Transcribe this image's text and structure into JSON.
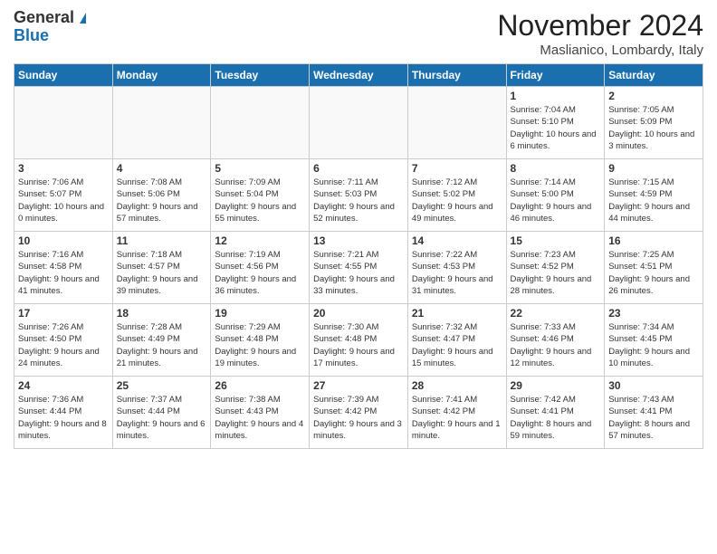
{
  "header": {
    "logo_general": "General",
    "logo_blue": "Blue",
    "title": "November 2024",
    "location": "Maslianico, Lombardy, Italy"
  },
  "days_of_week": [
    "Sunday",
    "Monday",
    "Tuesday",
    "Wednesday",
    "Thursday",
    "Friday",
    "Saturday"
  ],
  "weeks": [
    [
      {
        "day": "",
        "info": ""
      },
      {
        "day": "",
        "info": ""
      },
      {
        "day": "",
        "info": ""
      },
      {
        "day": "",
        "info": ""
      },
      {
        "day": "",
        "info": ""
      },
      {
        "day": "1",
        "info": "Sunrise: 7:04 AM\nSunset: 5:10 PM\nDaylight: 10 hours and 6 minutes."
      },
      {
        "day": "2",
        "info": "Sunrise: 7:05 AM\nSunset: 5:09 PM\nDaylight: 10 hours and 3 minutes."
      }
    ],
    [
      {
        "day": "3",
        "info": "Sunrise: 7:06 AM\nSunset: 5:07 PM\nDaylight: 10 hours and 0 minutes."
      },
      {
        "day": "4",
        "info": "Sunrise: 7:08 AM\nSunset: 5:06 PM\nDaylight: 9 hours and 57 minutes."
      },
      {
        "day": "5",
        "info": "Sunrise: 7:09 AM\nSunset: 5:04 PM\nDaylight: 9 hours and 55 minutes."
      },
      {
        "day": "6",
        "info": "Sunrise: 7:11 AM\nSunset: 5:03 PM\nDaylight: 9 hours and 52 minutes."
      },
      {
        "day": "7",
        "info": "Sunrise: 7:12 AM\nSunset: 5:02 PM\nDaylight: 9 hours and 49 minutes."
      },
      {
        "day": "8",
        "info": "Sunrise: 7:14 AM\nSunset: 5:00 PM\nDaylight: 9 hours and 46 minutes."
      },
      {
        "day": "9",
        "info": "Sunrise: 7:15 AM\nSunset: 4:59 PM\nDaylight: 9 hours and 44 minutes."
      }
    ],
    [
      {
        "day": "10",
        "info": "Sunrise: 7:16 AM\nSunset: 4:58 PM\nDaylight: 9 hours and 41 minutes."
      },
      {
        "day": "11",
        "info": "Sunrise: 7:18 AM\nSunset: 4:57 PM\nDaylight: 9 hours and 39 minutes."
      },
      {
        "day": "12",
        "info": "Sunrise: 7:19 AM\nSunset: 4:56 PM\nDaylight: 9 hours and 36 minutes."
      },
      {
        "day": "13",
        "info": "Sunrise: 7:21 AM\nSunset: 4:55 PM\nDaylight: 9 hours and 33 minutes."
      },
      {
        "day": "14",
        "info": "Sunrise: 7:22 AM\nSunset: 4:53 PM\nDaylight: 9 hours and 31 minutes."
      },
      {
        "day": "15",
        "info": "Sunrise: 7:23 AM\nSunset: 4:52 PM\nDaylight: 9 hours and 28 minutes."
      },
      {
        "day": "16",
        "info": "Sunrise: 7:25 AM\nSunset: 4:51 PM\nDaylight: 9 hours and 26 minutes."
      }
    ],
    [
      {
        "day": "17",
        "info": "Sunrise: 7:26 AM\nSunset: 4:50 PM\nDaylight: 9 hours and 24 minutes."
      },
      {
        "day": "18",
        "info": "Sunrise: 7:28 AM\nSunset: 4:49 PM\nDaylight: 9 hours and 21 minutes."
      },
      {
        "day": "19",
        "info": "Sunrise: 7:29 AM\nSunset: 4:48 PM\nDaylight: 9 hours and 19 minutes."
      },
      {
        "day": "20",
        "info": "Sunrise: 7:30 AM\nSunset: 4:48 PM\nDaylight: 9 hours and 17 minutes."
      },
      {
        "day": "21",
        "info": "Sunrise: 7:32 AM\nSunset: 4:47 PM\nDaylight: 9 hours and 15 minutes."
      },
      {
        "day": "22",
        "info": "Sunrise: 7:33 AM\nSunset: 4:46 PM\nDaylight: 9 hours and 12 minutes."
      },
      {
        "day": "23",
        "info": "Sunrise: 7:34 AM\nSunset: 4:45 PM\nDaylight: 9 hours and 10 minutes."
      }
    ],
    [
      {
        "day": "24",
        "info": "Sunrise: 7:36 AM\nSunset: 4:44 PM\nDaylight: 9 hours and 8 minutes."
      },
      {
        "day": "25",
        "info": "Sunrise: 7:37 AM\nSunset: 4:44 PM\nDaylight: 9 hours and 6 minutes."
      },
      {
        "day": "26",
        "info": "Sunrise: 7:38 AM\nSunset: 4:43 PM\nDaylight: 9 hours and 4 minutes."
      },
      {
        "day": "27",
        "info": "Sunrise: 7:39 AM\nSunset: 4:42 PM\nDaylight: 9 hours and 3 minutes."
      },
      {
        "day": "28",
        "info": "Sunrise: 7:41 AM\nSunset: 4:42 PM\nDaylight: 9 hours and 1 minute."
      },
      {
        "day": "29",
        "info": "Sunrise: 7:42 AM\nSunset: 4:41 PM\nDaylight: 8 hours and 59 minutes."
      },
      {
        "day": "30",
        "info": "Sunrise: 7:43 AM\nSunset: 4:41 PM\nDaylight: 8 hours and 57 minutes."
      }
    ]
  ]
}
